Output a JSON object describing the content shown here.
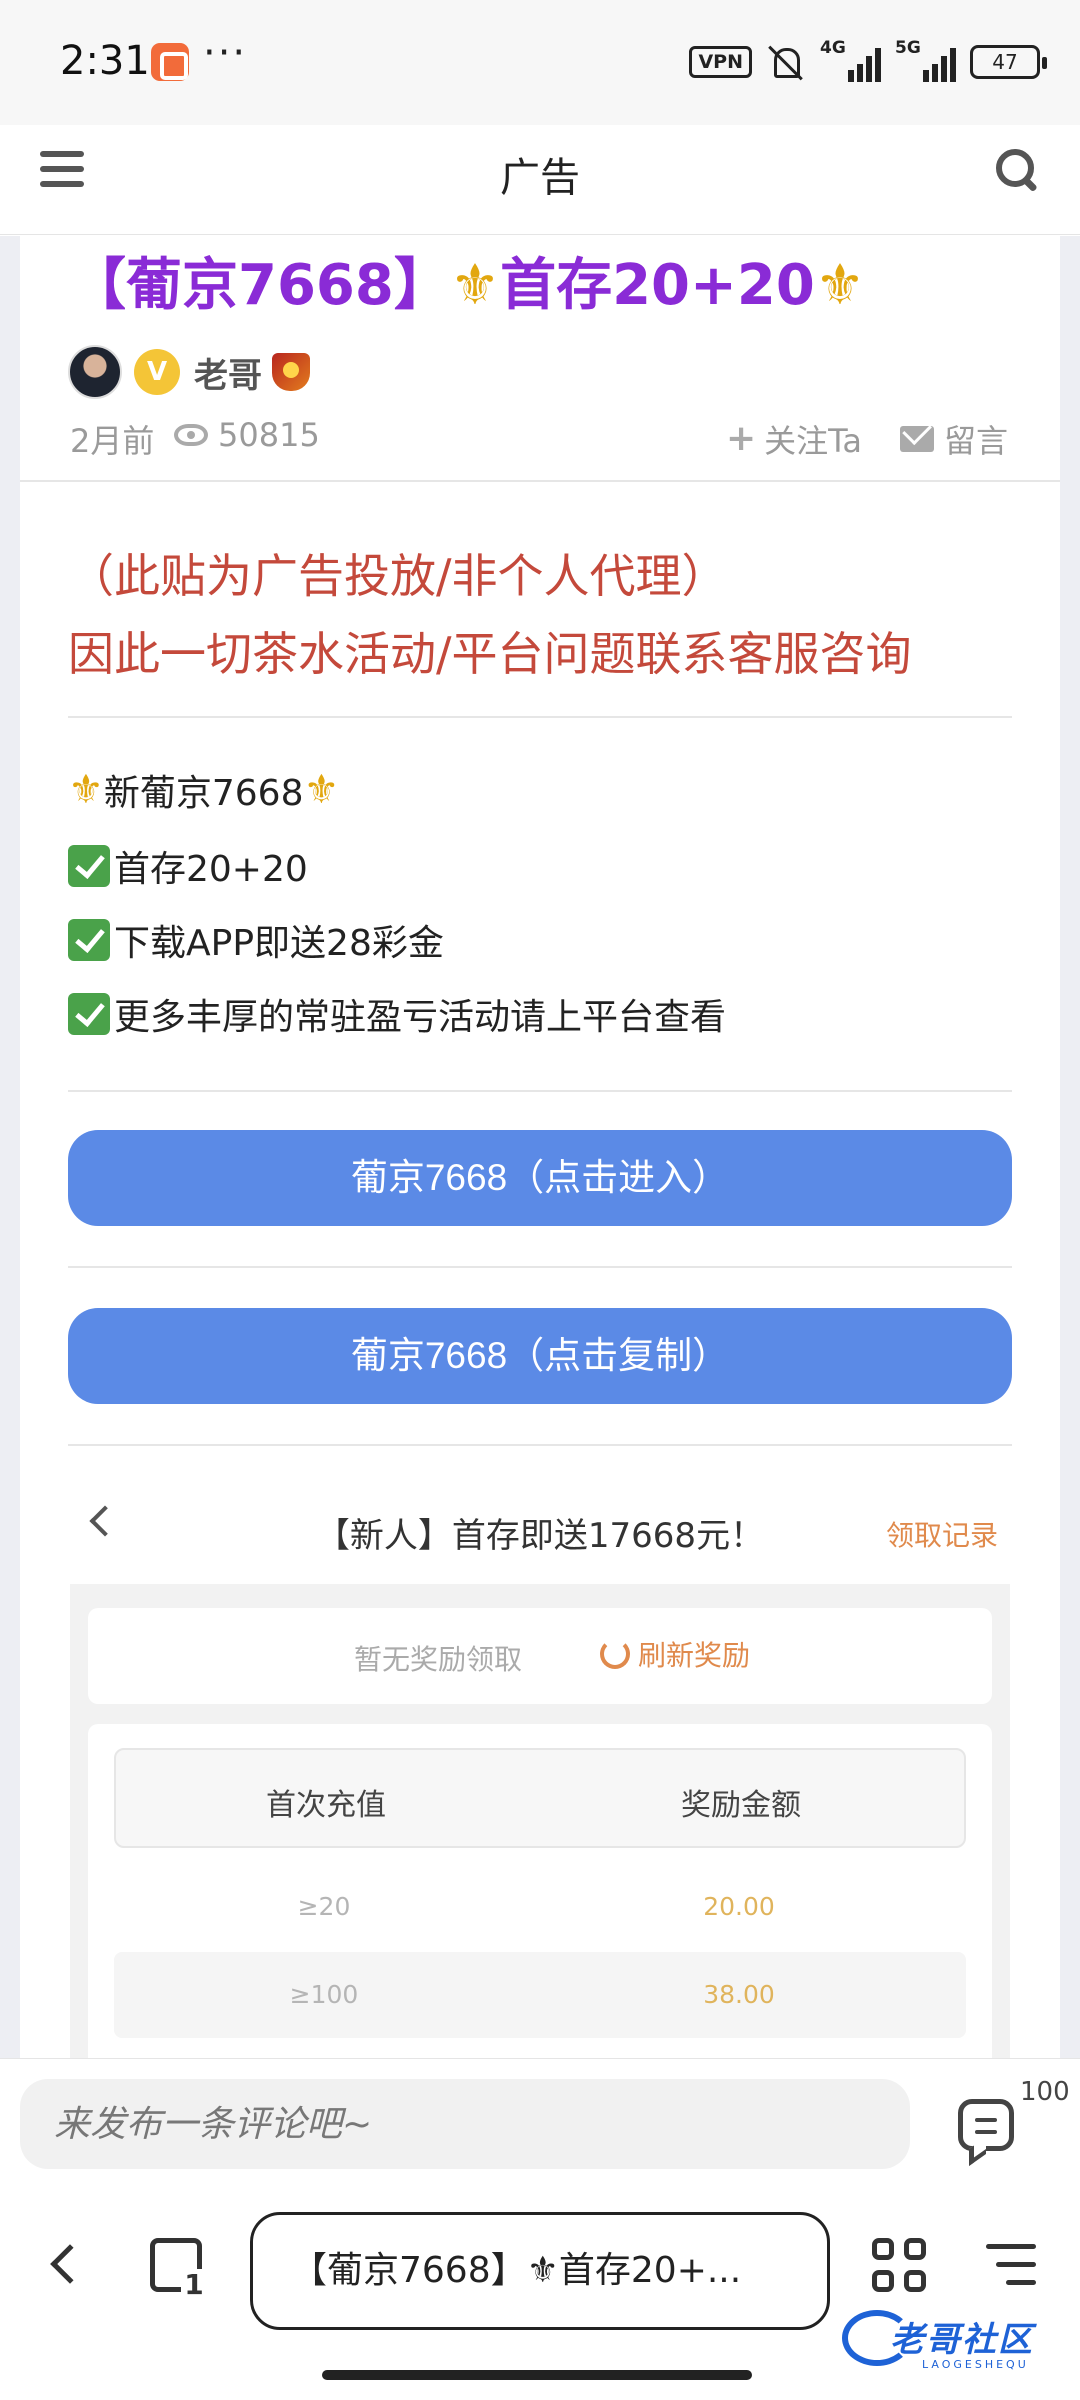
{
  "status_bar": {
    "time": "2:31",
    "dots": "···",
    "vpn": "VPN",
    "net1": "4G",
    "net2": "5G",
    "battery": "47"
  },
  "header": {
    "title": "广告"
  },
  "post": {
    "title_before": "【葡京7668】",
    "title_fleur": "⚜",
    "title_mid": "首存20+20",
    "author": {
      "name": "老哥",
      "badge": "V"
    },
    "meta": {
      "date": "2月前",
      "views": "50815",
      "follow": "关注Ta",
      "message": "留言"
    },
    "notice": [
      "（此贴为广告投放/非个人代理）",
      "因此一切茶水活动/平台问题联系客服咨询"
    ],
    "features": [
      {
        "prefix": "⚜",
        "text": "新葡京7668",
        "suffix": "⚜"
      },
      {
        "text": "首存20+20"
      },
      {
        "text": "下载APP即送28彩金"
      },
      {
        "text": "更多丰厚的常驻盈亏活动请上平台查看"
      }
    ],
    "buttons": {
      "enter": "葡京7668（点击进入）",
      "copy": "葡京7668（点击复制）"
    }
  },
  "promo": {
    "title": "【新人】首存即送17668元！",
    "record": "领取记录",
    "no_reward": "暂无奖励领取",
    "refresh": "刷新奖励",
    "table": {
      "headers": [
        "首次充值",
        "奖励金额"
      ],
      "rows": [
        [
          "≥20",
          "20.00"
        ],
        [
          "≥100",
          "38.00"
        ]
      ]
    }
  },
  "comment": {
    "placeholder": "来发布一条评论吧~",
    "count": "100"
  },
  "browser": {
    "tab_count": "1",
    "address": "【葡京7668】⚜首存20+..."
  },
  "watermark": {
    "text": "老哥社区",
    "sub": "LAOGESHEQU"
  },
  "colors": {
    "title": "#8a2bd6",
    "notice": "#c4493b",
    "button": "#5b8ae6",
    "accent_orange": "#e08a4c"
  }
}
